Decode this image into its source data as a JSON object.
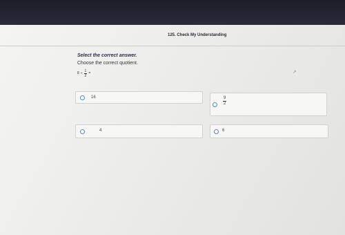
{
  "header": {
    "title": "125. Check My Understanding"
  },
  "question": {
    "instruction": "Select the correct answer.",
    "prompt": "Choose the correct quotient.",
    "expression": {
      "whole": "8",
      "operator": "÷",
      "numerator": "1",
      "denominator": "2",
      "equals": "="
    }
  },
  "choices": [
    {
      "label": "16"
    },
    {
      "numerator": "9",
      "denominator": "2"
    },
    {
      "label": "4"
    },
    {
      "label": "6"
    }
  ],
  "colors": {
    "radio_border": "#5a86b8",
    "instruction_text": "#2a2c50"
  }
}
